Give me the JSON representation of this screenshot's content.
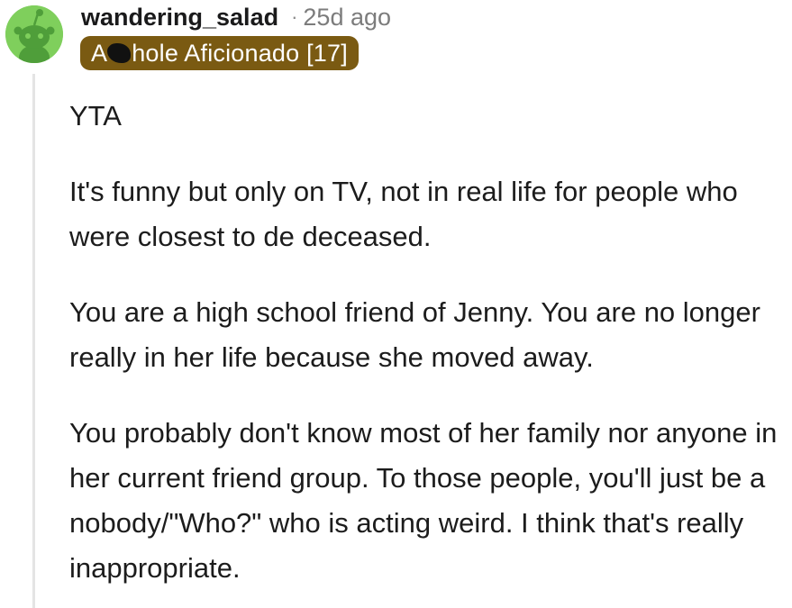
{
  "comment": {
    "author": "wandering_salad",
    "separator": "·",
    "age": "25d ago",
    "flair": {
      "text_before_redaction": "A",
      "text_after_redaction": "hole Aficionado [17]",
      "background": "#7a5a12",
      "text_color": "#ffffff"
    },
    "avatar": {
      "icon": "snoo-avatar-icon",
      "background": "#7fcf5c"
    },
    "paragraphs": [
      "YTA",
      "It's funny but only on TV, not in real life for people who were closest to de deceased.",
      "You are a high school friend of Jenny. You are no longer really in her life because she moved away.",
      "You probably don't know most of her family nor anyone in her current friend group. To those people, you'll just be a nobody/\"Who?\" who is acting weird. I think that's really inappropriate."
    ]
  }
}
